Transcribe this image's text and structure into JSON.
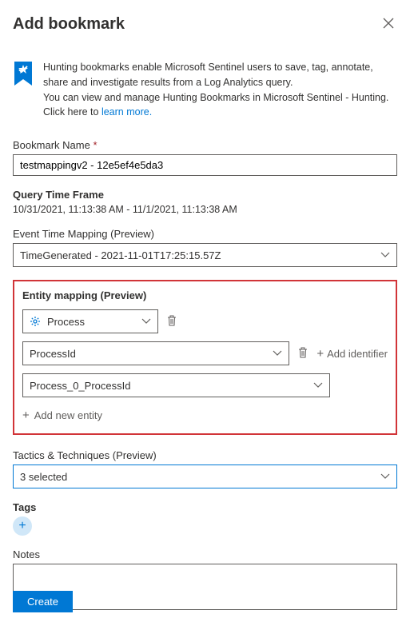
{
  "header": {
    "title": "Add bookmark"
  },
  "info": {
    "line1": "Hunting bookmarks enable Microsoft Sentinel users to save, tag, annotate, share and investigate results from a Log Analytics query.",
    "line2": "You can view and manage Hunting Bookmarks in Microsoft Sentinel - Hunting.",
    "clickHere": "Click here to ",
    "learnMore": "learn more."
  },
  "bookmarkName": {
    "label": "Bookmark Name",
    "value": "testmappingv2 - 12e5ef4e5da3"
  },
  "queryTimeFrame": {
    "label": "Query Time Frame",
    "value": "10/31/2021, 11:13:38 AM - 11/1/2021, 11:13:38 AM"
  },
  "eventTimeMapping": {
    "label": "Event Time Mapping (Preview)",
    "value": "TimeGenerated - 2021-11-01T17:25:15.57Z"
  },
  "entityMapping": {
    "label": "Entity mapping (Preview)",
    "entitySelect": "Process",
    "identifierSelect": "ProcessId",
    "valueSelect": "Process_0_ProcessId",
    "addIdentifier": "Add identifier",
    "addNewEntity": "Add new entity"
  },
  "tactics": {
    "label": "Tactics & Techniques (Preview)",
    "value": "3 selected"
  },
  "tags": {
    "label": "Tags"
  },
  "notes": {
    "label": "Notes"
  },
  "footer": {
    "create": "Create"
  }
}
